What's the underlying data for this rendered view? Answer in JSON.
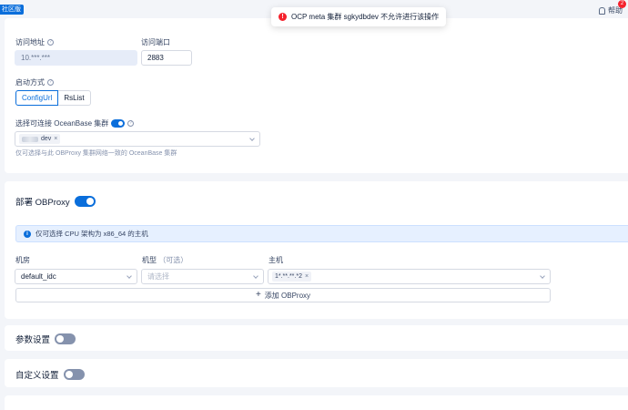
{
  "header": {
    "brand_tag": "社区版",
    "help_label": "帮助",
    "notification_count": "2"
  },
  "toast": {
    "message": "OCP meta 集群 sgkydbdev 不允许进行该操作"
  },
  "access": {
    "address_label": "访问地址",
    "address_value": "10.***.***",
    "port_label": "访问端口",
    "port_value": "2883"
  },
  "startup": {
    "label": "启动方式",
    "options": [
      "ConfigUrl",
      "RsList"
    ],
    "selected": "ConfigUrl"
  },
  "cluster": {
    "label": "选择可连接 OceanBase 集群",
    "toggle_on": true,
    "selected_tag": "dev",
    "hint": "仅可选择与此 OBProxy 集群网络一致的 OceanBase 集群"
  },
  "deploy": {
    "title": "部署 OBProxy",
    "toggle_on": true,
    "alert": "仅可选择 CPU 架构为 x86_64 的主机",
    "col_idc": "机房",
    "col_type": "机型",
    "col_type_optional": "（可选）",
    "col_host": "主机",
    "idc_value": "default_idc",
    "type_placeholder": "请选择",
    "host_tag": "1*.**.**.*2",
    "add_label": "添加 OBProxy"
  },
  "params": {
    "title": "参数设置",
    "toggle_on": false
  },
  "custom": {
    "title": "自定义设置",
    "toggle_on": false
  },
  "colors": {
    "primary": "#0a6edb",
    "error": "#f5222d",
    "toggle_off": "#8592ad",
    "page_bg": "#f3f5f9"
  }
}
